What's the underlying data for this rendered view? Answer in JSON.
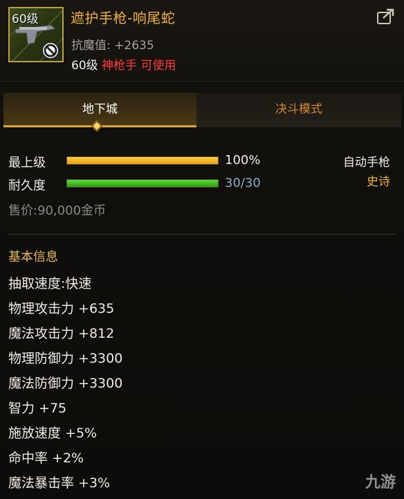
{
  "item": {
    "level_badge": "60级",
    "name": "遮护手枪-响尾蛇",
    "stat_label": "抗魔值:",
    "stat_value": "+2635",
    "req_level": "60级",
    "req_class": "神枪手 可使用"
  },
  "tabs": [
    {
      "label": "地下城",
      "active": true
    },
    {
      "label": "决斗模式",
      "active": false
    }
  ],
  "bars": {
    "grade_label": "最上级",
    "grade_percent": 100,
    "grade_text": "100%",
    "durability_label": "耐久度",
    "durability_current": 30,
    "durability_max": 30,
    "durability_text": "30/30"
  },
  "weapon_type": "自动手枪",
  "rarity": "史诗",
  "colors": {
    "rarity": "#f0b030",
    "title": "#f0b040",
    "class_req": "#ff3a3a"
  },
  "price": "售价:90,000金币",
  "section_title": "基本信息",
  "attributes": [
    "抽取速度:快速",
    "物理攻击力 +635",
    "魔法攻击力 +812",
    "物理防御力 +3300",
    "魔法防御力 +3300",
    "智力 +75",
    "施放速度 +5%",
    "命中率 +2%",
    "魔法暴击率 +3%"
  ],
  "watermark": "九游",
  "icons": {
    "share": "share-icon",
    "forbidden": "forbidden-icon"
  }
}
